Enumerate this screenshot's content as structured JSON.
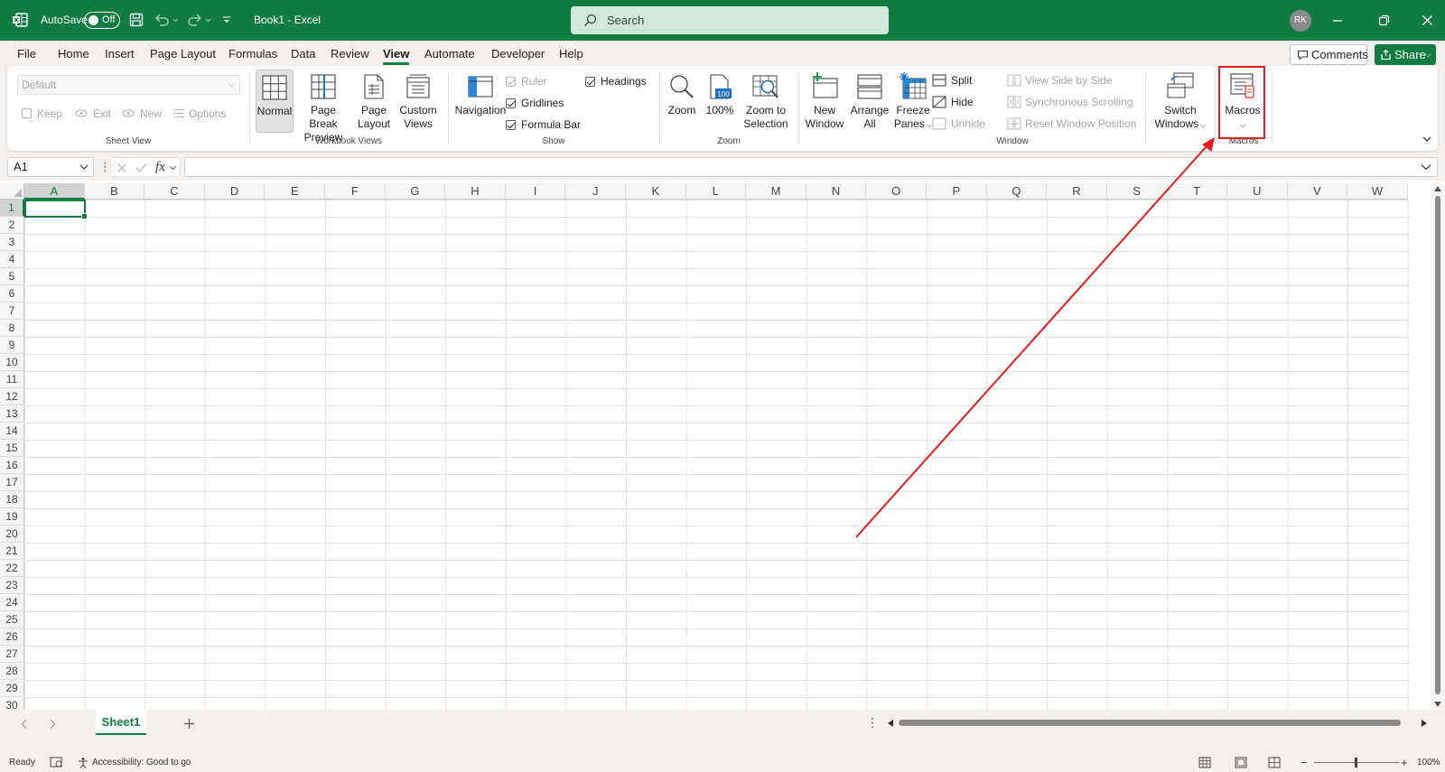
{
  "titlebar": {
    "autosave_label": "AutoSave",
    "autosave_state": "Off",
    "doc_title": "Book1  -  Excel",
    "search_placeholder": "Search",
    "user_initials": "RK"
  },
  "menu": {
    "tabs": [
      "File",
      "Home",
      "Insert",
      "Page Layout",
      "Formulas",
      "Data",
      "Review",
      "View",
      "Automate",
      "Developer",
      "Help"
    ],
    "active": "View",
    "comments_label": "Comments",
    "share_label": "Share"
  },
  "ribbon": {
    "sheet_view": {
      "dropdown_value": "Default",
      "keep": "Keep",
      "exit": "Exit",
      "new": "New",
      "options": "Options",
      "label": "Sheet View"
    },
    "workbook_views": {
      "normal": "Normal",
      "page_break_1": "Page Break",
      "page_break_2": "Preview",
      "page_layout_1": "Page",
      "page_layout_2": "Layout",
      "custom_1": "Custom",
      "custom_2": "Views",
      "label": "Workbook Views"
    },
    "show": {
      "navigation": "Navigation",
      "ruler": "Ruler",
      "gridlines": "Gridlines",
      "formula_bar": "Formula Bar",
      "headings": "Headings",
      "label": "Show"
    },
    "zoom": {
      "zoom": "Zoom",
      "hundred": "100%",
      "zoom_sel_1": "Zoom to",
      "zoom_sel_2": "Selection",
      "label": "Zoom"
    },
    "window": {
      "new_1": "New",
      "new_2": "Window",
      "arrange_1": "Arrange",
      "arrange_2": "All",
      "freeze_1": "Freeze",
      "freeze_2": "Panes",
      "split": "Split",
      "hide": "Hide",
      "unhide": "Unhide",
      "view_side": "View Side by Side",
      "sync_scroll": "Synchronous Scrolling",
      "reset_pos": "Reset Window Position",
      "switch_1": "Switch",
      "switch_2": "Windows",
      "label": "Window"
    },
    "macros": {
      "macros": "Macros",
      "label": "Macros"
    }
  },
  "formula": {
    "name_box": "A1",
    "fx": "fx",
    "value": ""
  },
  "grid": {
    "columns": [
      "A",
      "B",
      "C",
      "D",
      "E",
      "F",
      "G",
      "H",
      "I",
      "J",
      "K",
      "L",
      "M",
      "N",
      "O",
      "P",
      "Q",
      "R",
      "S",
      "T",
      "U",
      "V",
      "W"
    ],
    "rows": [
      "1",
      "2",
      "3",
      "4",
      "5",
      "6",
      "7",
      "8",
      "9",
      "10",
      "11",
      "12",
      "13",
      "14",
      "15",
      "16",
      "17",
      "18",
      "19",
      "20",
      "21",
      "22",
      "23",
      "24",
      "25",
      "26",
      "27",
      "28",
      "29",
      "30"
    ],
    "selected_cell": "A1"
  },
  "sheets": {
    "tabs": [
      "Sheet1"
    ],
    "active": "Sheet1"
  },
  "status": {
    "ready": "Ready",
    "accessibility": "Accessibility: Good to go",
    "zoom_level": "100%"
  },
  "colors": {
    "brand": "#107c41",
    "annotation": "#e81b1b"
  }
}
